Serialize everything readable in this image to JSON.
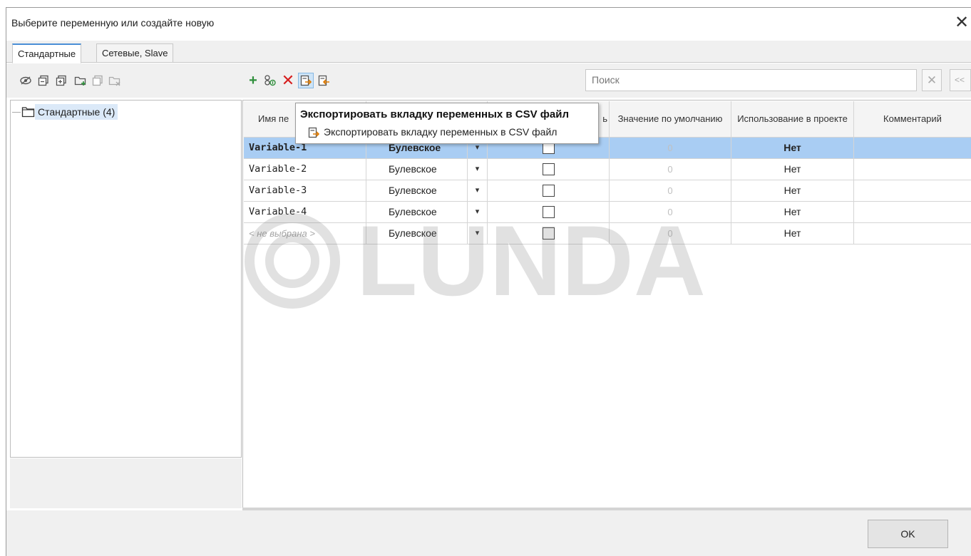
{
  "window": {
    "title": "Выберите переменную или создайте новую",
    "close_glyph": "✕"
  },
  "tabs": [
    {
      "label": "Стандартные",
      "active": true
    },
    {
      "label": "Сетевые, Slave",
      "active": false
    }
  ],
  "left_toolbar": {
    "icons": [
      "eye-icon",
      "copy-group-icon",
      "paste-group-icon",
      "add-folder-icon",
      "copy-icon",
      "delete-folder-icon"
    ]
  },
  "grid_toolbar": {
    "icons": [
      "add-icon",
      "add-variable-icon",
      "delete-icon",
      "export-csv-icon",
      "import-csv-icon"
    ],
    "add_glyph": "+",
    "delete_glyph": "✕"
  },
  "search": {
    "placeholder": "Поиск",
    "clear_glyph": "✕",
    "prev_glyph": "<<"
  },
  "tree": {
    "root_label": "Стандартные  (4)"
  },
  "tooltip": {
    "title": "Экспортировать вкладку переменных в CSV файл",
    "subtitle": "Экспортировать вкладку переменных в CSV файл"
  },
  "table": {
    "columns": {
      "name": "Имя пе",
      "name_tail": "ь",
      "default": "Значение по умолчанию",
      "usage": "Использование в проекте",
      "comment": "Комментарий"
    },
    "dropdown_glyph": "▾",
    "rows": [
      {
        "name": "Variable-1",
        "type": "Булевское",
        "checked": false,
        "default": "0",
        "usage": "Нет",
        "comment": "",
        "selected": true
      },
      {
        "name": "Variable-2",
        "type": "Булевское",
        "checked": false,
        "default": "0",
        "usage": "Нет",
        "comment": "",
        "selected": false
      },
      {
        "name": "Variable-3",
        "type": "Булевское",
        "checked": false,
        "default": "0",
        "usage": "Нет",
        "comment": "",
        "selected": false
      },
      {
        "name": "Variable-4",
        "type": "Булевское",
        "checked": false,
        "default": "0",
        "usage": "Нет",
        "comment": "",
        "selected": false
      },
      {
        "name": "< не выбрана >",
        "type": "Булевское",
        "checked": false,
        "default": "0",
        "usage": "Нет",
        "comment": "",
        "selected": false
      }
    ]
  },
  "watermark": {
    "text": "LUNDA"
  },
  "footer": {
    "ok_label": "OK"
  },
  "colors": {
    "selection": "#a9cdf3",
    "tab_accent": "#4a8fd6",
    "add_green": "#2f8f3c",
    "delete_red": "#d61f1f"
  }
}
